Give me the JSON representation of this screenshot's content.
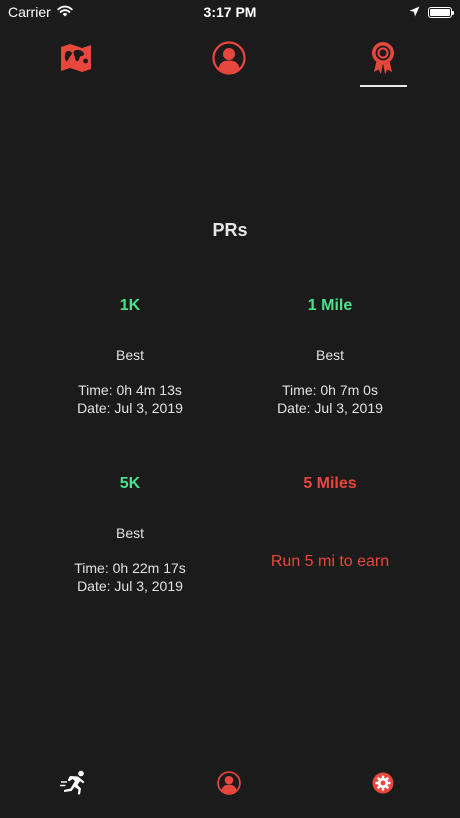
{
  "status_bar": {
    "carrier": "Carrier",
    "time": "3:17 PM"
  },
  "top_tabs": [
    {
      "icon": "world-map-icon"
    },
    {
      "icon": "profile-icon"
    },
    {
      "icon": "award-ribbon-icon",
      "selected": true
    }
  ],
  "page": {
    "title": "PRs"
  },
  "records": [
    {
      "name": "1K",
      "status": "earned",
      "best_label": "Best",
      "time": "Time: 0h 4m 13s",
      "date": "Date: Jul 3, 2019"
    },
    {
      "name": "1 Mile",
      "status": "earned",
      "best_label": "Best",
      "time": "Time: 0h 7m 0s",
      "date": "Date: Jul 3, 2019"
    },
    {
      "name": "5K",
      "status": "earned",
      "best_label": "Best",
      "time": "Time: 0h 22m 17s",
      "date": "Date: Jul 3, 2019"
    },
    {
      "name": "5 Miles",
      "status": "locked",
      "earn_text": "Run 5 mi to earn"
    }
  ],
  "bottom_bar": [
    {
      "icon": "runner-icon"
    },
    {
      "icon": "profile-icon"
    },
    {
      "icon": "gear-icon"
    }
  ],
  "colors": {
    "background": "#1b1b1b",
    "accent_red": "#e8473d",
    "earned_green": "#4ee08a"
  }
}
